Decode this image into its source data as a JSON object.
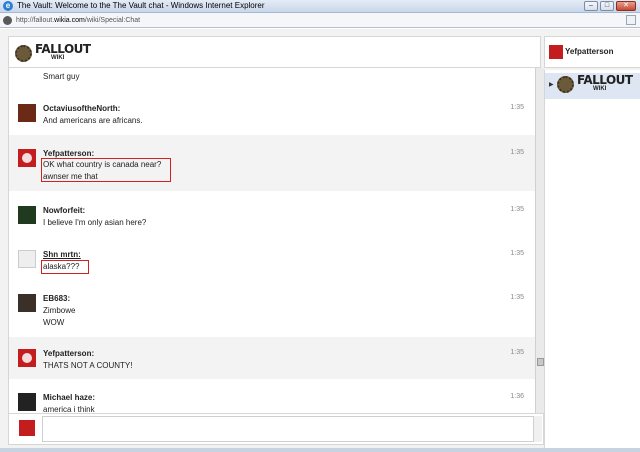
{
  "window": {
    "title": "The Vault: Welcome to the The Vault chat - Windows Internet Explorer"
  },
  "address": {
    "url_prefix": "http://fallout.",
    "url_domain": "wikia.com",
    "url_suffix": "/wiki/Special:Chat"
  },
  "logo": {
    "word": "FALLOUT",
    "sub": "WIKI"
  },
  "current_user": {
    "name": "Yefpatterson"
  },
  "messages": [
    {
      "user": "",
      "lines": [
        "Smart guy"
      ],
      "time": ""
    },
    {
      "user": "OctaviusoftheNorth:",
      "lines": [
        "And americans are africans."
      ],
      "time": "1:35"
    },
    {
      "user": "Yefpatterson:",
      "lines": [
        "OK what country is canada near?",
        "awnser me that"
      ],
      "time": "1:35"
    },
    {
      "user": "Nowforfeit:",
      "lines": [
        "I believe I'm only asian here?"
      ],
      "time": "1:35"
    },
    {
      "user": "Shn mrtn:",
      "lines": [
        "alaska???"
      ],
      "time": "1:35"
    },
    {
      "user": "EB683:",
      "lines": [
        "Zimbowe",
        "WOW"
      ],
      "time": "1:35"
    },
    {
      "user": "Yefpatterson:",
      "lines": [
        "THATS NOT A COUNTY!"
      ],
      "time": "1:35"
    },
    {
      "user": "Michael haze:",
      "lines": [
        "america i think"
      ],
      "time": "1:36"
    }
  ],
  "colors": {
    "accent_red": "#c41d1d",
    "highlight_border": "#d02020",
    "room_selected": "#dde6f2"
  }
}
